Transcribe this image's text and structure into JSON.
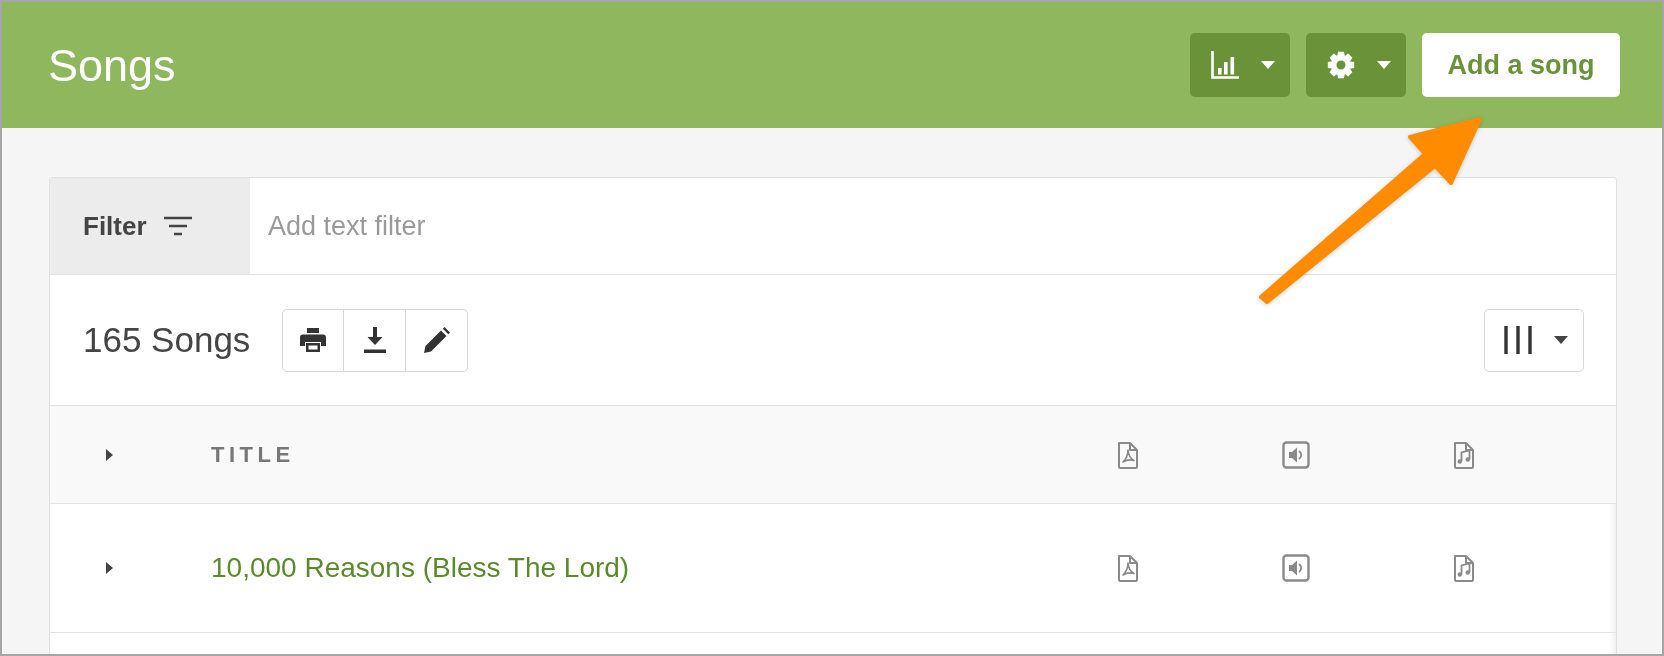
{
  "header": {
    "title": "Songs",
    "buttons": [
      {
        "kind": "chart",
        "dropdown": true
      },
      {
        "kind": "settings",
        "dropdown": true
      },
      {
        "kind": "text",
        "label": "Add a song"
      }
    ]
  },
  "filter": {
    "label": "Filter",
    "placeholder": "Add text filter"
  },
  "toolbar": {
    "count": "165 Songs",
    "actions": [
      {
        "kind": "print"
      },
      {
        "kind": "download"
      },
      {
        "kind": "edit"
      }
    ],
    "view_menu": {
      "kind": "columns",
      "dropdown": true
    }
  },
  "table": {
    "expander": {
      "expanded": false
    },
    "columns": [
      {
        "kind": "title",
        "label": "TITLE"
      },
      {
        "kind": "pdf"
      },
      {
        "kind": "audio"
      },
      {
        "kind": "sheet-music"
      }
    ],
    "rows": [
      {
        "expanded": false,
        "title": "10,000 Reasons (Bless The Lord)",
        "files": [
          {
            "kind": "pdf"
          },
          {
            "kind": "audio"
          },
          {
            "kind": "sheet-music"
          }
        ]
      }
    ]
  },
  "annotation": {
    "kind": "arrow"
  }
}
